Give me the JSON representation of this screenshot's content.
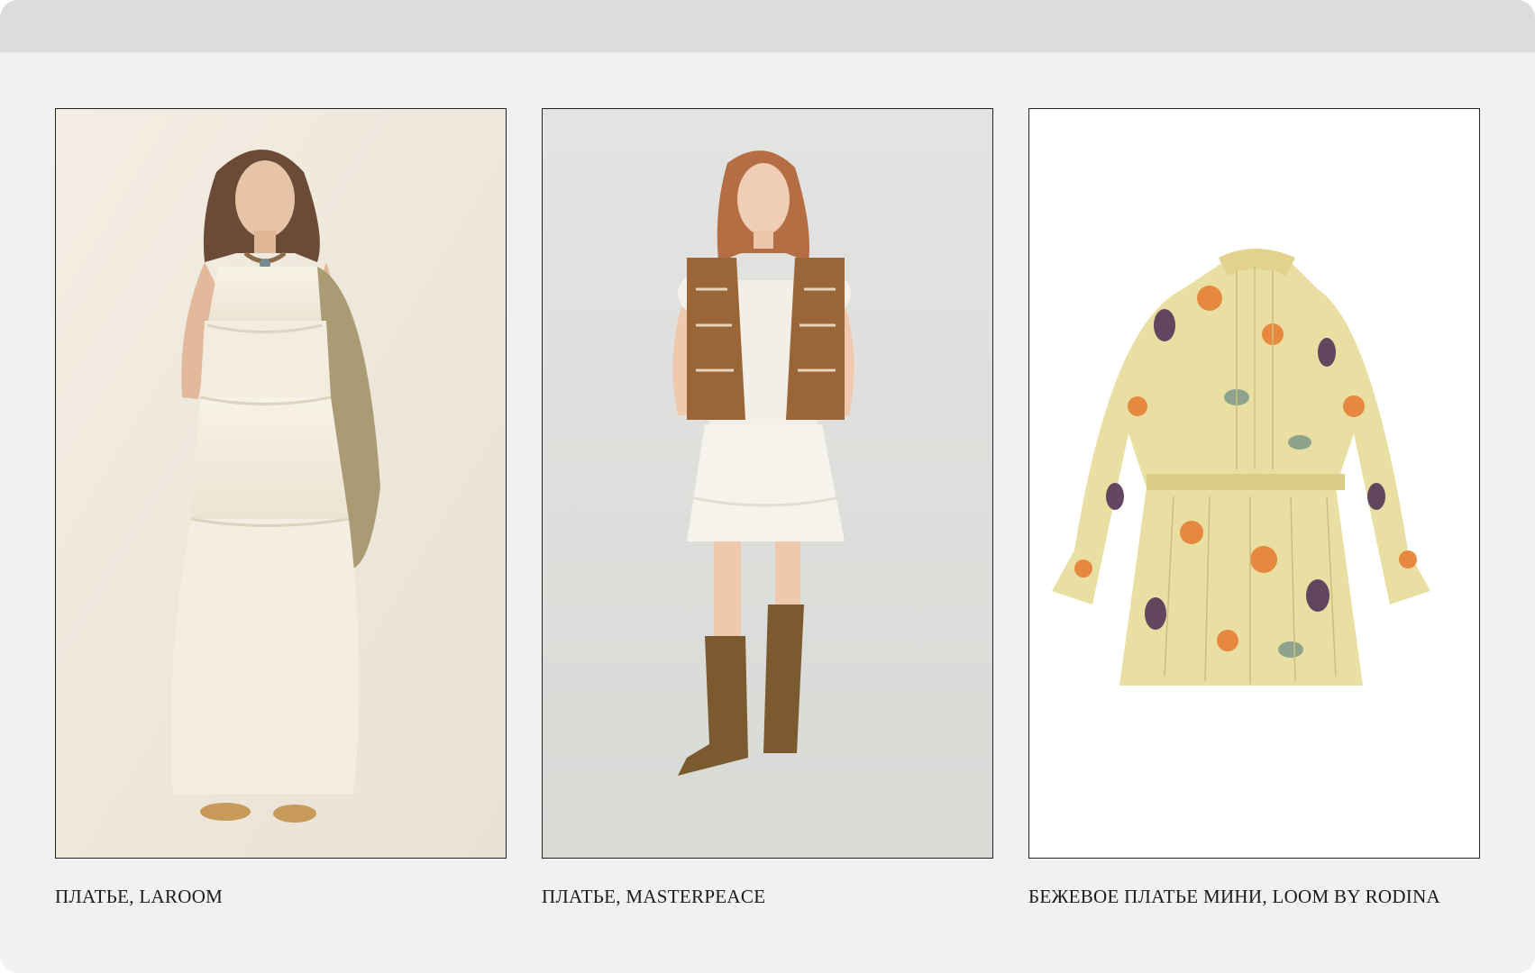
{
  "products": [
    {
      "caption": "ПЛАТЬЕ, LAROOM",
      "image_icon": "model-white-tiered-dress-image"
    },
    {
      "caption": "ПЛАТЬЕ, MASTERPEACE",
      "image_icon": "model-lace-dress-vest-boots-image"
    },
    {
      "caption": "БЕЖЕВОЕ ПЛАТЬЕ МИНИ, LOOM BY RODINA",
      "image_icon": "floral-mini-dress-image"
    }
  ],
  "colors": {
    "page_bg": "#f1f1f1",
    "topbar_bg": "#dcdcdc",
    "card_border": "#222222",
    "photo1_bg": "#efe8dd",
    "photo2_bg": "#dcdedb",
    "photo3_bg": "#ffffff"
  }
}
